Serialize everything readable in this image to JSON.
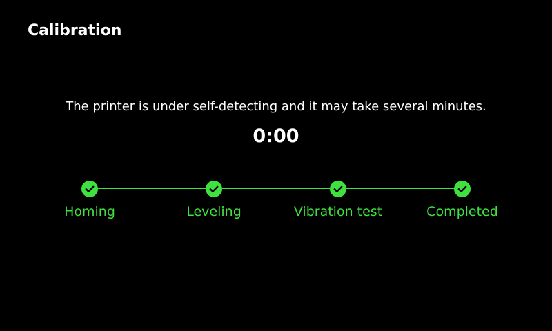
{
  "header": {
    "title": "Calibration"
  },
  "status": {
    "message": "The printer is under self-detecting and it may take several minutes.",
    "timer": "0:00"
  },
  "steps": [
    {
      "label": "Homing",
      "state": "completed",
      "icon": "check-icon"
    },
    {
      "label": "Leveling",
      "state": "completed",
      "icon": "check-icon"
    },
    {
      "label": "Vibration test",
      "state": "completed",
      "icon": "check-icon"
    },
    {
      "label": "Completed",
      "state": "completed",
      "icon": "check-icon"
    }
  ],
  "colors": {
    "background": "#000000",
    "text": "#ffffff",
    "accent": "#3fe03f",
    "check_mark": "#000000"
  }
}
